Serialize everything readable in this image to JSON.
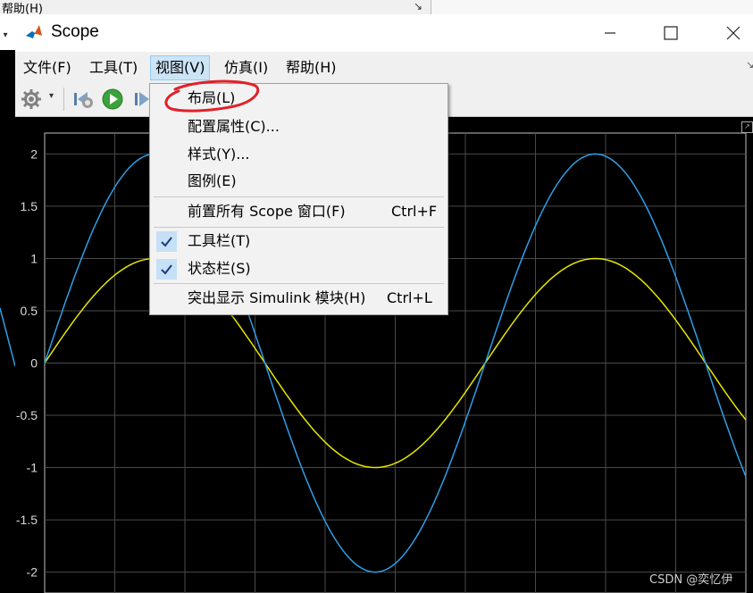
{
  "background_app": {
    "help_menu": "帮助(H)",
    "pin_icon": "pin-icon"
  },
  "window": {
    "title": "Scope",
    "controls": [
      "minimize-icon",
      "maximize-icon",
      "close-icon"
    ]
  },
  "menubar": {
    "items": [
      {
        "label": "文件(F)"
      },
      {
        "label": "工具(T)"
      },
      {
        "label": "视图(V)"
      },
      {
        "label": "仿真(I)"
      },
      {
        "label": "帮助(H)"
      }
    ]
  },
  "toolbar": {
    "icons": [
      "gear-icon",
      "dropdown-icon",
      "step-back-icon",
      "run-icon",
      "step-forward-icon"
    ]
  },
  "view_menu": {
    "items": [
      {
        "label": "布局(L)",
        "shortcut": "",
        "checked": false
      },
      {
        "label": "配置属性(C)...",
        "shortcut": "",
        "checked": false
      },
      {
        "label": "样式(Y)...",
        "shortcut": "",
        "checked": false
      },
      {
        "label": "图例(E)",
        "shortcut": "",
        "checked": false
      },
      {
        "label": "前置所有 Scope 窗口(F)",
        "shortcut": "Ctrl+F",
        "checked": false
      },
      {
        "label": "工具栏(T)",
        "shortcut": "",
        "checked": true
      },
      {
        "label": "状态栏(S)",
        "shortcut": "",
        "checked": true
      },
      {
        "label": "突出显示 Simulink 模块(H)",
        "shortcut": "Ctrl+L",
        "checked": false
      }
    ],
    "highlight_annotation_color": "#e0202a"
  },
  "chart_data": {
    "type": "line",
    "x_range": [
      0,
      10
    ],
    "ylim": [
      -2.2,
      2.2
    ],
    "yticks": [
      "2",
      "1.5",
      "1",
      "0.5",
      "0",
      "-0.5",
      "-1",
      "-1.5",
      "-2"
    ],
    "grid": true,
    "background": "#000000",
    "series": [
      {
        "color": "#e6e600",
        "amplitude": 1,
        "function": "sin(t)",
        "t_end": 10.0
      },
      {
        "color": "#2f9ee6",
        "amplitude": 2,
        "function": "2*sin(t)",
        "t_end": 10.0
      }
    ]
  },
  "watermark": "CSDN @奕忆伊"
}
